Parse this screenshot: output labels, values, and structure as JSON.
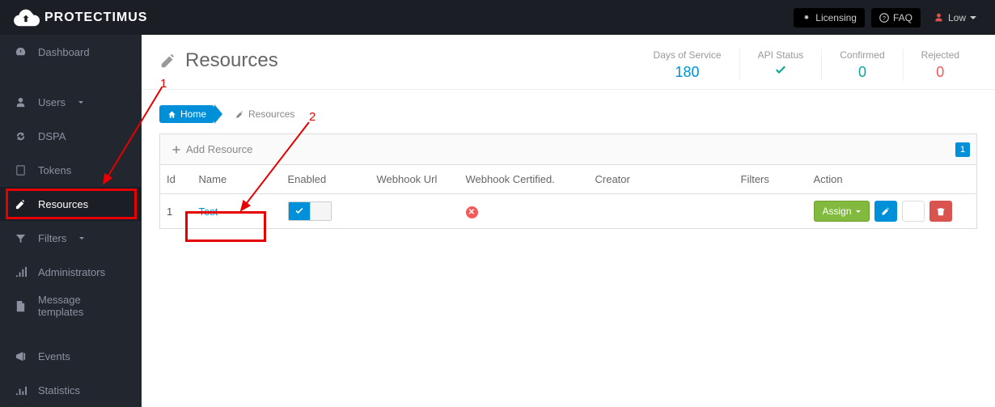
{
  "brand": "PROTECTIMUS",
  "topbar": {
    "licensing": "Licensing",
    "faq": "FAQ",
    "user": "Low"
  },
  "sidebar": {
    "dashboard": "Dashboard",
    "users": "Users",
    "dspa": "DSPA",
    "tokens": "Tokens",
    "resources": "Resources",
    "filters": "Filters",
    "administrators": "Administrators",
    "templates": "Message templates",
    "events": "Events",
    "statistics": "Statistics"
  },
  "page": {
    "title": "Resources",
    "stats": {
      "service_label": "Days of Service",
      "service_value": "180",
      "api_label": "API Status",
      "confirmed_label": "Confirmed",
      "confirmed_value": "0",
      "rejected_label": "Rejected",
      "rejected_value": "0"
    }
  },
  "breadcrumb": {
    "home": "Home",
    "current": "Resources"
  },
  "table": {
    "add": "Add Resource",
    "page_badge": "1",
    "columns": {
      "id": "Id",
      "name": "Name",
      "enabled": "Enabled",
      "webhook": "Webhook Url",
      "certified": "Webhook Certified.",
      "creator": "Creator",
      "filters": "Filters",
      "action": "Action"
    },
    "rows": [
      {
        "id": "1",
        "name": "Test",
        "webhook": "",
        "creator": "",
        "filters": ""
      }
    ],
    "assign": "Assign"
  },
  "annotations": {
    "one": "1",
    "two": "2"
  }
}
